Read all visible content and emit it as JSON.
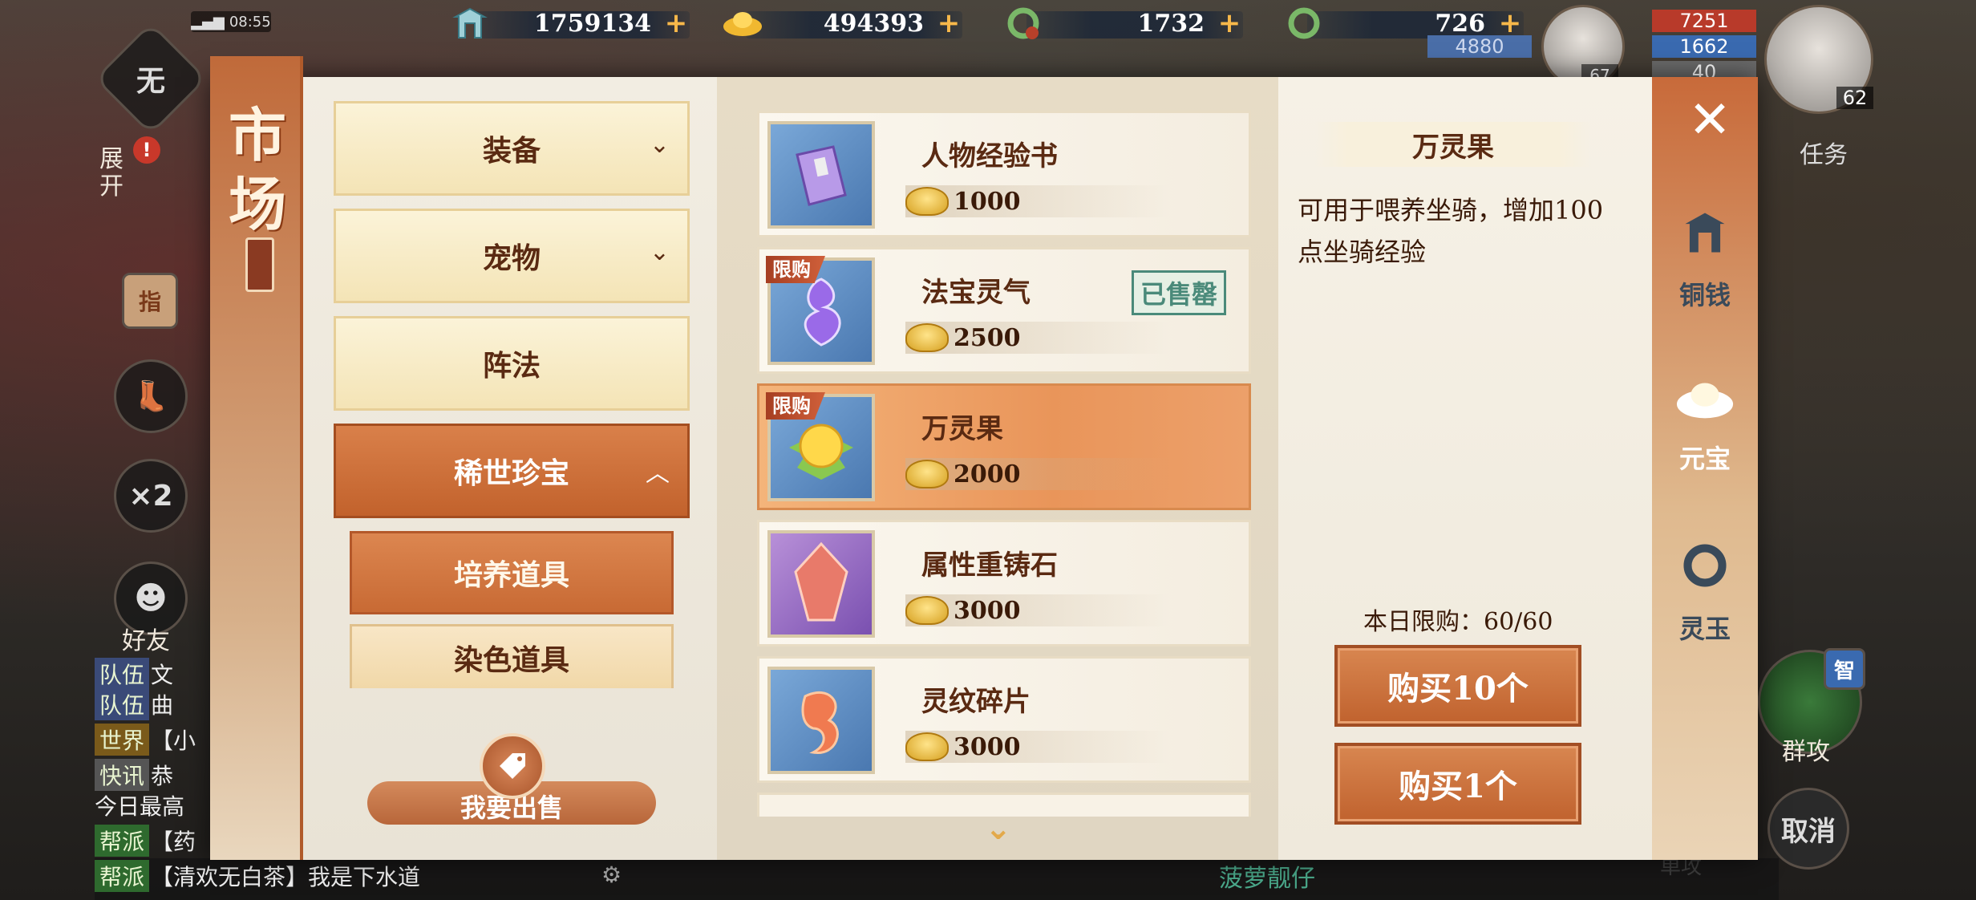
{
  "status": {
    "time": "08:55"
  },
  "currencies": [
    {
      "icon": "copper-tower-icon",
      "value": "1759134"
    },
    {
      "icon": "gold-ingot-icon",
      "value": "494393"
    },
    {
      "icon": "bound-jade-dragon-icon",
      "value": "1732"
    },
    {
      "icon": "jade-dragon-icon",
      "value": "726"
    }
  ],
  "currency_plus": "+",
  "player_stats": {
    "hp": "7251",
    "mp": "1662",
    "exp": "40",
    "mana": "4880",
    "pet_level": "67",
    "level": "62"
  },
  "hud": {
    "expand_label": "展开",
    "wu_label": "无",
    "zhi_label": "指",
    "speed_label": "×2",
    "friend_label": "好友",
    "task_label": "任务",
    "group_attack_label": "群攻",
    "zhi2_label": "智",
    "cancel_label": "取消",
    "single_attack_label": "单攻",
    "exclaim": "!"
  },
  "chat": [
    {
      "tag": "队伍",
      "text": "文"
    },
    {
      "tag": "队伍",
      "text": "曲"
    },
    {
      "tag": "世界",
      "text": "【小"
    },
    {
      "tag": "快讯",
      "text": "恭"
    },
    {
      "tag": "",
      "text": "今日最高"
    },
    {
      "tag": "帮派",
      "text": "【药"
    },
    {
      "tag": "帮派",
      "text": "【清欢无白茶】我是下水道"
    }
  ],
  "bottom_name": "菠萝靓仔",
  "market": {
    "title_1": "市",
    "title_2": "场",
    "categories": [
      {
        "label": "装备",
        "chevron": "⌄"
      },
      {
        "label": "宠物",
        "chevron": "⌄"
      },
      {
        "label": "阵法",
        "chevron": ""
      },
      {
        "label": "稀世珍宝",
        "chevron": "︿"
      }
    ],
    "subcategories": [
      "培养道具",
      "染色道具"
    ],
    "sell_label": "我要出售",
    "items": [
      {
        "name": "人物经验书",
        "price": "1000",
        "icon": "exp-book-icon",
        "limited": "",
        "sold_out": ""
      },
      {
        "name": "法宝灵气",
        "price": "2500",
        "icon": "spirit-flame-icon",
        "limited": "限购",
        "sold_out": "已售罄"
      },
      {
        "name": "万灵果",
        "price": "2000",
        "icon": "spirit-fruit-icon",
        "limited": "限购",
        "sold_out": ""
      },
      {
        "name": "属性重铸石",
        "price": "3000",
        "icon": "recast-stone-icon",
        "limited": "",
        "sold_out": ""
      },
      {
        "name": "灵纹碎片",
        "price": "3000",
        "icon": "rune-fragment-icon",
        "limited": "",
        "sold_out": ""
      }
    ],
    "detail": {
      "title": "万灵果",
      "description": "可用于喂养坐骑，增加100点坐骑经验",
      "daily_limit": "本日限购：60/60",
      "buy10": "购买10个",
      "buy1": "购买1个"
    },
    "tabs": [
      {
        "label": "铜钱",
        "icon": "copper-tower-icon"
      },
      {
        "label": "元宝",
        "icon": "gold-ingot-icon"
      },
      {
        "label": "灵玉",
        "icon": "jade-dragon-icon"
      }
    ]
  },
  "colors": {
    "accent": "#c8682f",
    "panel_bg": "#f4efe4",
    "text": "#5a2a12"
  }
}
